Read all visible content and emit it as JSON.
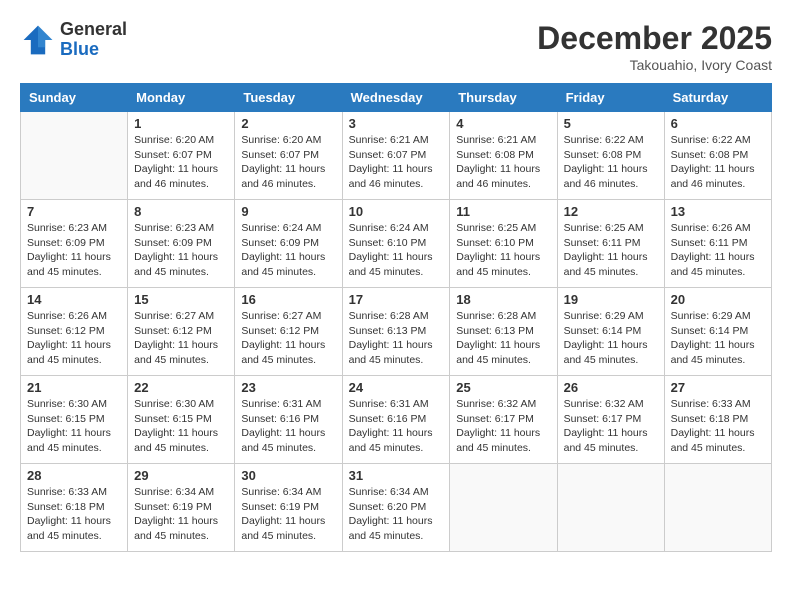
{
  "header": {
    "logo_general": "General",
    "logo_blue": "Blue",
    "month_year": "December 2025",
    "location": "Takouahio, Ivory Coast"
  },
  "calendar": {
    "days_of_week": [
      "Sunday",
      "Monday",
      "Tuesday",
      "Wednesday",
      "Thursday",
      "Friday",
      "Saturday"
    ],
    "weeks": [
      [
        {
          "day": null,
          "info": null
        },
        {
          "day": "1",
          "info": "Sunrise: 6:20 AM\nSunset: 6:07 PM\nDaylight: 11 hours and 46 minutes."
        },
        {
          "day": "2",
          "info": "Sunrise: 6:20 AM\nSunset: 6:07 PM\nDaylight: 11 hours and 46 minutes."
        },
        {
          "day": "3",
          "info": "Sunrise: 6:21 AM\nSunset: 6:07 PM\nDaylight: 11 hours and 46 minutes."
        },
        {
          "day": "4",
          "info": "Sunrise: 6:21 AM\nSunset: 6:08 PM\nDaylight: 11 hours and 46 minutes."
        },
        {
          "day": "5",
          "info": "Sunrise: 6:22 AM\nSunset: 6:08 PM\nDaylight: 11 hours and 46 minutes."
        },
        {
          "day": "6",
          "info": "Sunrise: 6:22 AM\nSunset: 6:08 PM\nDaylight: 11 hours and 46 minutes."
        }
      ],
      [
        {
          "day": "7",
          "info": "Sunrise: 6:23 AM\nSunset: 6:09 PM\nDaylight: 11 hours and 45 minutes."
        },
        {
          "day": "8",
          "info": "Sunrise: 6:23 AM\nSunset: 6:09 PM\nDaylight: 11 hours and 45 minutes."
        },
        {
          "day": "9",
          "info": "Sunrise: 6:24 AM\nSunset: 6:09 PM\nDaylight: 11 hours and 45 minutes."
        },
        {
          "day": "10",
          "info": "Sunrise: 6:24 AM\nSunset: 6:10 PM\nDaylight: 11 hours and 45 minutes."
        },
        {
          "day": "11",
          "info": "Sunrise: 6:25 AM\nSunset: 6:10 PM\nDaylight: 11 hours and 45 minutes."
        },
        {
          "day": "12",
          "info": "Sunrise: 6:25 AM\nSunset: 6:11 PM\nDaylight: 11 hours and 45 minutes."
        },
        {
          "day": "13",
          "info": "Sunrise: 6:26 AM\nSunset: 6:11 PM\nDaylight: 11 hours and 45 minutes."
        }
      ],
      [
        {
          "day": "14",
          "info": "Sunrise: 6:26 AM\nSunset: 6:12 PM\nDaylight: 11 hours and 45 minutes."
        },
        {
          "day": "15",
          "info": "Sunrise: 6:27 AM\nSunset: 6:12 PM\nDaylight: 11 hours and 45 minutes."
        },
        {
          "day": "16",
          "info": "Sunrise: 6:27 AM\nSunset: 6:12 PM\nDaylight: 11 hours and 45 minutes."
        },
        {
          "day": "17",
          "info": "Sunrise: 6:28 AM\nSunset: 6:13 PM\nDaylight: 11 hours and 45 minutes."
        },
        {
          "day": "18",
          "info": "Sunrise: 6:28 AM\nSunset: 6:13 PM\nDaylight: 11 hours and 45 minutes."
        },
        {
          "day": "19",
          "info": "Sunrise: 6:29 AM\nSunset: 6:14 PM\nDaylight: 11 hours and 45 minutes."
        },
        {
          "day": "20",
          "info": "Sunrise: 6:29 AM\nSunset: 6:14 PM\nDaylight: 11 hours and 45 minutes."
        }
      ],
      [
        {
          "day": "21",
          "info": "Sunrise: 6:30 AM\nSunset: 6:15 PM\nDaylight: 11 hours and 45 minutes."
        },
        {
          "day": "22",
          "info": "Sunrise: 6:30 AM\nSunset: 6:15 PM\nDaylight: 11 hours and 45 minutes."
        },
        {
          "day": "23",
          "info": "Sunrise: 6:31 AM\nSunset: 6:16 PM\nDaylight: 11 hours and 45 minutes."
        },
        {
          "day": "24",
          "info": "Sunrise: 6:31 AM\nSunset: 6:16 PM\nDaylight: 11 hours and 45 minutes."
        },
        {
          "day": "25",
          "info": "Sunrise: 6:32 AM\nSunset: 6:17 PM\nDaylight: 11 hours and 45 minutes."
        },
        {
          "day": "26",
          "info": "Sunrise: 6:32 AM\nSunset: 6:17 PM\nDaylight: 11 hours and 45 minutes."
        },
        {
          "day": "27",
          "info": "Sunrise: 6:33 AM\nSunset: 6:18 PM\nDaylight: 11 hours and 45 minutes."
        }
      ],
      [
        {
          "day": "28",
          "info": "Sunrise: 6:33 AM\nSunset: 6:18 PM\nDaylight: 11 hours and 45 minutes."
        },
        {
          "day": "29",
          "info": "Sunrise: 6:34 AM\nSunset: 6:19 PM\nDaylight: 11 hours and 45 minutes."
        },
        {
          "day": "30",
          "info": "Sunrise: 6:34 AM\nSunset: 6:19 PM\nDaylight: 11 hours and 45 minutes."
        },
        {
          "day": "31",
          "info": "Sunrise: 6:34 AM\nSunset: 6:20 PM\nDaylight: 11 hours and 45 minutes."
        },
        {
          "day": null,
          "info": null
        },
        {
          "day": null,
          "info": null
        },
        {
          "day": null,
          "info": null
        }
      ]
    ]
  }
}
